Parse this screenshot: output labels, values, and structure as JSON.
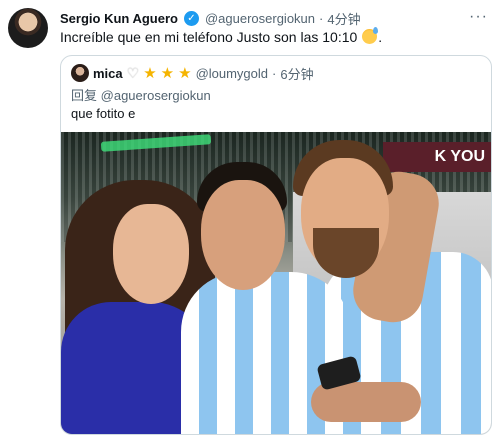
{
  "tweet": {
    "author_name": "Sergio Kun Aguero",
    "verified_mark": "✓",
    "handle": "@aguerosergiokun",
    "separator": "·",
    "time": "4分钟",
    "text": "Increíble que en mi teléfono Justo son las 10:10",
    "text_tail": ".",
    "more_icon": "···"
  },
  "quote": {
    "author_name": "mica",
    "heart_icon": "♡",
    "stars": [
      "★",
      "★",
      "★"
    ],
    "handle": "@loumygold",
    "separator": "·",
    "time": "6分钟",
    "reply_prefix": "回复",
    "reply_to": "@aguerosergiokun",
    "text": "que fotito e"
  },
  "colors": {
    "verified": "#1d9bf0",
    "secondary_text": "#536471",
    "star": "#f5b400",
    "border": "#cfd9de"
  },
  "photo": {
    "banner_text": "K YOU"
  }
}
